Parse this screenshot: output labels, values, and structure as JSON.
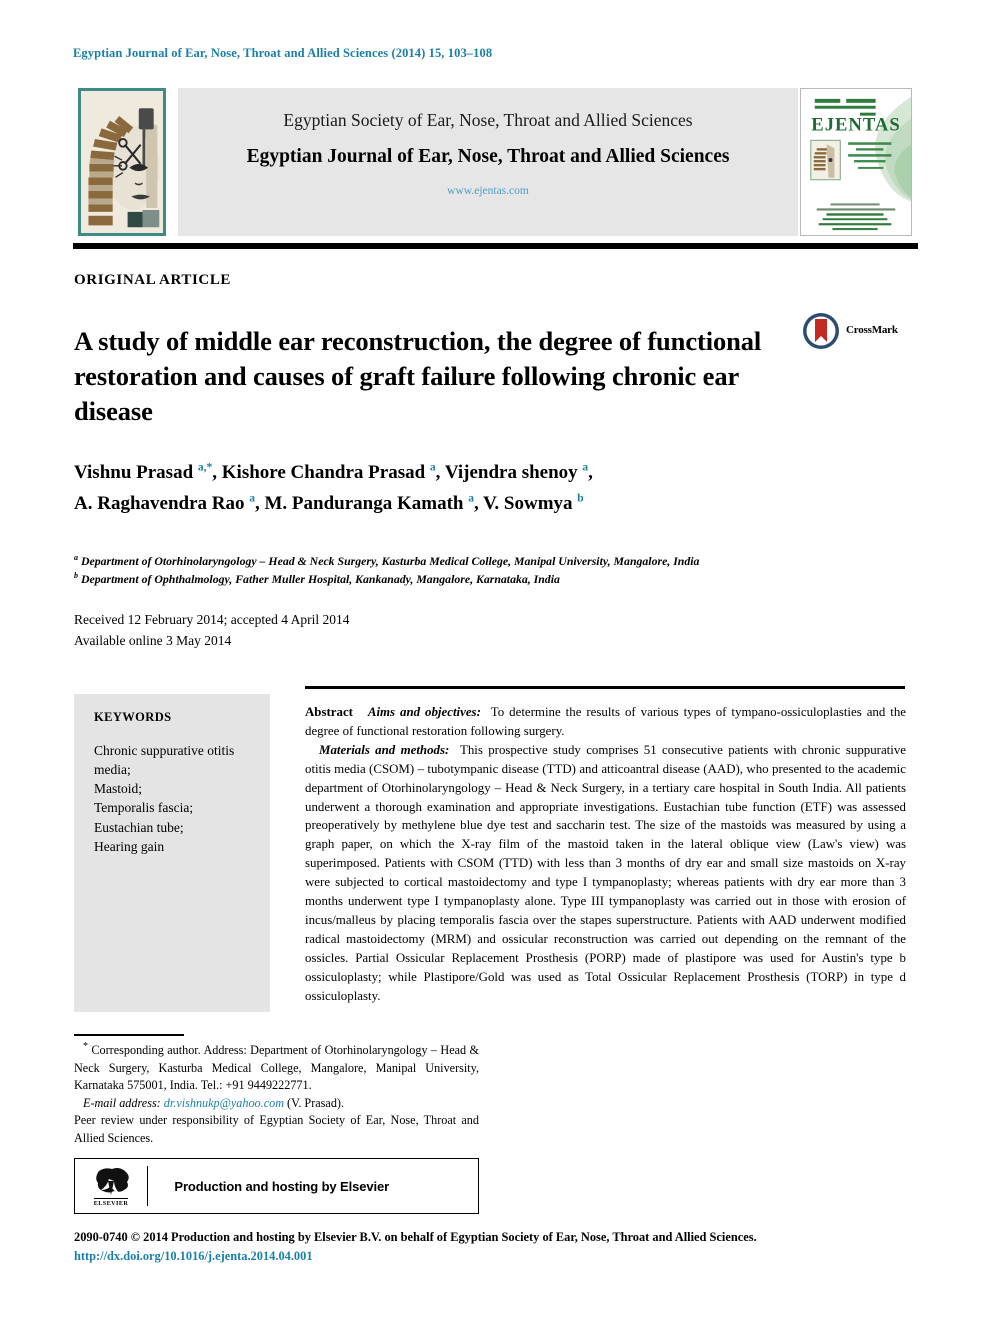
{
  "citation": "Egyptian Journal of Ear, Nose, Throat and Allied Sciences (2014) 15, 103–108",
  "header": {
    "society": "Egyptian Society of Ear, Nose, Throat and Allied Sciences",
    "journal_title": "Egyptian Journal of Ear, Nose, Throat and Allied Sciences",
    "url": "www.ejentas.com",
    "cover_wordmark": "EJENTAS",
    "logo_alt": "pharaoh-head-society-logo",
    "accent_teal": "#3e8a84",
    "accent_blue": "#1a7fa8",
    "cover_green": "#1f6b34",
    "band_gray": "#e6e6e6"
  },
  "article": {
    "type": "ORIGINAL ARTICLE",
    "title": "A study of middle ear reconstruction, the degree of functional restoration and causes of graft failure following chronic ear disease",
    "crossmark_label": "CrossMark"
  },
  "authors": {
    "line1": "Vishnu Prasad ",
    "line1_sup": "a,*",
    "line1_b": ", Kishore Chandra Prasad ",
    "line1_sup2": "a",
    "line1_c": ", Vijendra shenoy ",
    "line1_sup3": "a",
    "line1_d": ",",
    "line2": "A. Raghavendra Rao ",
    "line2_sup": "a",
    "line2_b": ", M. Panduranga Kamath ",
    "line2_sup2": "a",
    "line2_c": ", V. Sowmya ",
    "line2_sup3": "b"
  },
  "affiliations": [
    {
      "mark": "a",
      "text": "Department of Otorhinolaryngology – Head & Neck Surgery, Kasturba Medical College, Manipal University, Mangalore, India"
    },
    {
      "mark": "b",
      "text": "Department of Ophthalmology, Father Muller Hospital, Kankanady, Mangalore, Karnataka, India"
    }
  ],
  "history": {
    "received": "Received 12 February 2014; accepted 4 April 2014",
    "available": "Available online 3 May 2014"
  },
  "keywords": {
    "heading": "KEYWORDS",
    "items": [
      "Chronic suppurative otitis media;",
      "Mastoid;",
      "Temporalis fascia;",
      "Eustachian tube;",
      "Hearing gain"
    ]
  },
  "abstract": {
    "label": "Abstract",
    "aims_label": "Aims and objectives:",
    "aims_text": "To determine the results of various types of tympano-ossiculoplasties and the degree of functional restoration following surgery.",
    "methods_label": "Materials and methods:",
    "methods_text": "This prospective study comprises 51 consecutive patients with chronic suppurative otitis media (CSOM) – tubotympanic disease (TTD) and atticoantral disease (AAD), who presented to the academic department of Otorhinolaryngology – Head & Neck Surgery, in a tertiary care hospital in South India. All patients underwent a thorough examination and appropriate investigations. Eustachian tube function (ETF) was assessed preoperatively by methylene blue dye test and saccharin test. The size of the mastoids was measured by using a graph paper, on which the X-ray film of the mastoid taken in the lateral oblique view (Law's view) was superimposed. Patients with CSOM (TTD) with less than 3 months of dry ear and small size mastoids on X-ray were subjected to cortical mastoidectomy and type I tympanoplasty; whereas patients with dry ear more than 3 months underwent type I tympanoplasty alone. Type III tympanoplasty was carried out in those with erosion of incus/malleus by placing temporalis fascia over the stapes superstructure. Patients with AAD underwent modified radical mastoidectomy (MRM) and ossicular reconstruction was carried out depending on the remnant of the ossicles. Partial Ossicular Replacement Prosthesis (PORP) made of plastipore was used for Austin's type b ossiculoplasty; while Plastipore/Gold was used as Total Ossicular Replacement Prosthesis (TORP) in type d ossiculoplasty."
  },
  "footnotes": {
    "corresponding": "Corresponding author. Address: Department of Otorhinolaryngology – Head & Neck Surgery, Kasturba Medical College, Mangalore, Manipal University, Karnataka 575001, India. Tel.: +91 9449222771.",
    "corresponding_mark": "*",
    "email_lead": "E-mail address:",
    "email": "dr.vishnukp@yahoo.com",
    "email_tail": "(V. Prasad).",
    "peer_review": "Peer review under responsibility of Egyptian Society of Ear, Nose, Throat and Allied Sciences."
  },
  "elsevier": {
    "text": "Production and hosting by Elsevier",
    "wordmark": "ELSEVIER"
  },
  "footer": {
    "copyright": "2090-0740 © 2014 Production and hosting by Elsevier B.V. on behalf of Egyptian Society of Ear, Nose, Throat and Allied Sciences.",
    "doi": "http://dx.doi.org/10.1016/j.ejenta.2014.04.001"
  }
}
